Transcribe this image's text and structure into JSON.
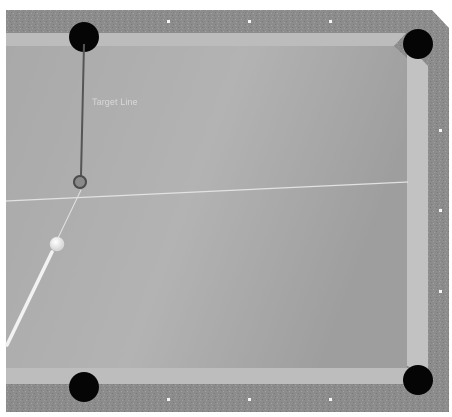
{
  "hud": {
    "target_line_label": "Target Line"
  },
  "colors": {
    "rail": "#8a8a8a",
    "rail_speckle": "#a5a5a5",
    "cushion": "#b5b5b5",
    "felt_light": "#b7b7b7",
    "felt_dark": "#9a9a9a",
    "pocket": "#050505",
    "cue_ball": "#f4f4f4",
    "aim_line": "#e8e8e8",
    "target_line": "#5a5a5a",
    "diamond": "#f5f5f5"
  },
  "game": {
    "pockets": [
      "top-left",
      "top-right",
      "bottom-left",
      "bottom-right"
    ],
    "cue_ball": "cue-ball",
    "ghost_ball": "ghost-ball",
    "cue_stick": "cue-stick"
  }
}
